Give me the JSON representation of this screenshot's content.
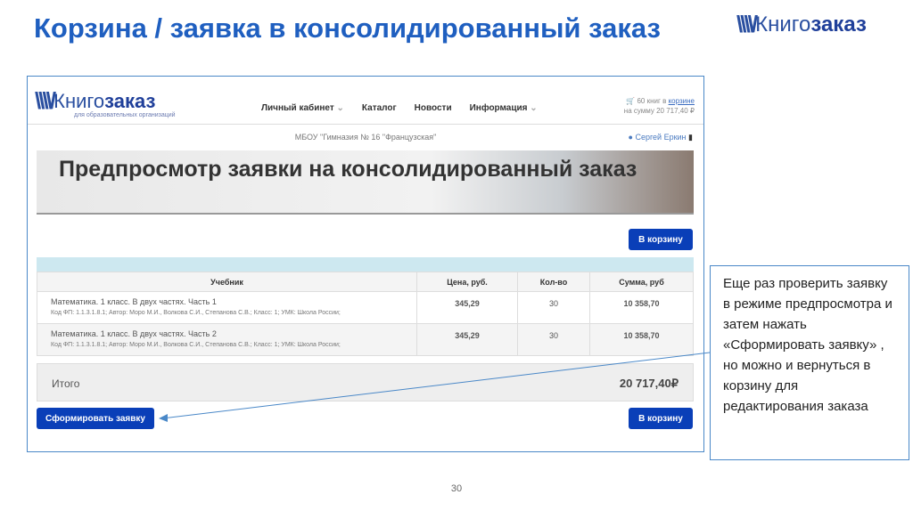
{
  "slide": {
    "title": "Корзина / заявка в консолидированный заказ",
    "page_number": "30",
    "logo": {
      "light": "Книго",
      "bold": "заказ"
    },
    "callout": "Еще раз проверить заявку в режиме предпросмотра и затем нажать «Сформировать заявку» , но можно и вернуться в корзину для редактирования заказа"
  },
  "site": {
    "logo": {
      "light": "Книго",
      "bold": "заказ",
      "subtitle": "для образовательных организаций"
    },
    "nav": [
      "Личный кабинет",
      "Каталог",
      "Новости",
      "Информация"
    ],
    "cart": {
      "line1": "60 книг в ",
      "link": "корзине",
      "line2": "на сумму 20 717,40 ₽"
    },
    "school": "МБОУ \"Гимназия № 16 \"Французская\"",
    "user": "Сергей Еркин",
    "banner": "Предпросмотр заявки на консолидированный заказ",
    "to_cart": "В корзину",
    "table": {
      "headers": [
        "Учебник",
        "Цена, руб.",
        "Кол-во",
        "Сумма, руб"
      ],
      "rows": [
        {
          "name": "Математика. 1 класс. В двух частях. Часть 1",
          "details": "Код ФП: 1.1.3.1.8.1; Автор: Моро М.И., Волкова С.И., Степанова С.В.; Класс: 1; УМК: Школа России;",
          "price": "345,29",
          "qty": "30",
          "sum": "10 358,70"
        },
        {
          "name": "Математика. 1 класс. В двух частях. Часть 2",
          "details": "Код ФП: 1.1.3.1.8.1; Автор: Моро М.И., Волкова С.И., Степанова С.В.; Класс: 1; УМК: Школа России;",
          "price": "345,29",
          "qty": "30",
          "sum": "10 358,70"
        }
      ]
    },
    "total_label": "Итого",
    "total_value": "20 717,40₽",
    "submit": "Сформировать заявку"
  }
}
